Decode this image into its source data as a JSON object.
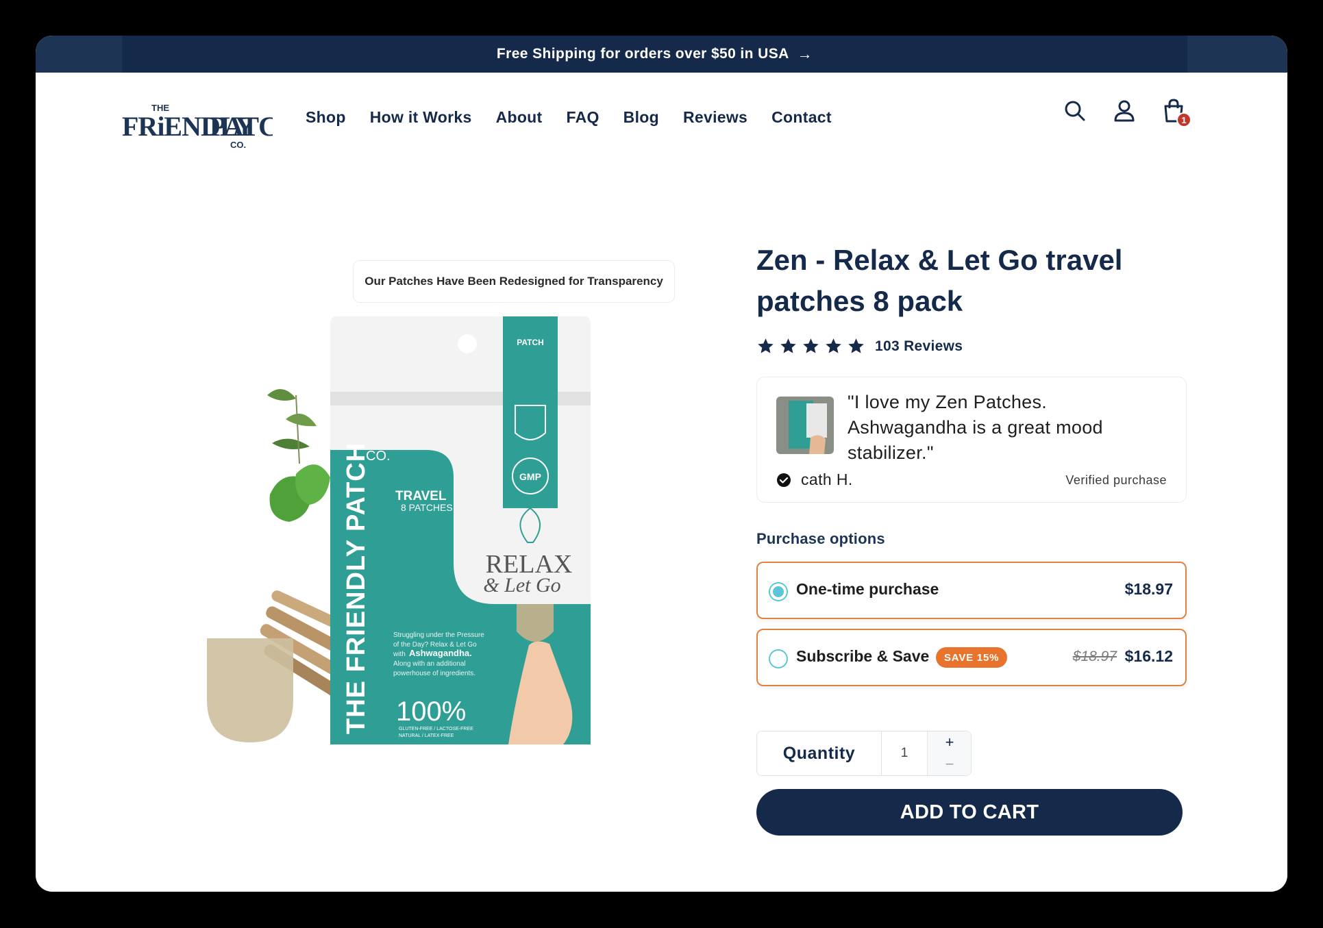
{
  "announcement": {
    "text": "Free Shipping for orders over $50 in USA",
    "arrow": "→"
  },
  "brand": {
    "name": "The Friendly Patch Co."
  },
  "nav": {
    "items": [
      {
        "label": "Shop"
      },
      {
        "label": "How it Works"
      },
      {
        "label": "About"
      },
      {
        "label": "FAQ"
      },
      {
        "label": "Blog"
      },
      {
        "label": "Reviews"
      },
      {
        "label": "Contact"
      }
    ]
  },
  "header_icons": {
    "search": "search-icon",
    "account": "user-icon",
    "cart": "cart-bag-icon",
    "cart_count": "1"
  },
  "product_image": {
    "notice": "Our Patches Have Been Redesigned for Transparency",
    "package_text": {
      "brand_vertical": "THE FRIENDLY PATCH",
      "co": "CO.",
      "type": "TRAVEL",
      "count": "8 PATCHES",
      "tab": "PATCH",
      "product_name_line1": "RELAX",
      "product_name_line2": "& Let Go",
      "description_line1": "Struggling under the Pressure",
      "description_line2": "of the Day? Relax & Let Go",
      "description_line3": "with",
      "description_highlight": "Ashwagandha.",
      "description_line4": "Along with an additional",
      "description_line5": "powerhouse of ingredients.",
      "percent": "100%",
      "claims_line1": "GLUTEN-FREE / LACTOSE-FREE",
      "claims_line2": "NATURAL / LATEX-FREE",
      "gmp": "GMP"
    }
  },
  "product": {
    "title": "Zen - Relax & Let Go travel patches 8 pack",
    "rating": 5,
    "reviews_label": "103 Reviews"
  },
  "review": {
    "quote": "\"I love my Zen Patches. Ashwagandha is a great mood stabilizer.\"",
    "author": "cath H.",
    "verified": "Verified purchase"
  },
  "purchase": {
    "label": "Purchase options",
    "one_time": {
      "label": "One-time purchase",
      "price": "$18.97",
      "selected": true
    },
    "subscribe": {
      "label": "Subscribe & Save",
      "badge": "SAVE 15%",
      "old_price": "$18.97",
      "price": "$16.12",
      "selected": false
    }
  },
  "quantity": {
    "label": "Quantity",
    "value": "1",
    "plus": "+",
    "minus": "−"
  },
  "cta": {
    "add_to_cart": "ADD TO CART"
  },
  "colors": {
    "navy": "#15294a",
    "teal": "#2f9e94",
    "accent_orange": "#e8732c",
    "radio_blue": "#5bc6d8",
    "badge_red": "#c2362b"
  }
}
